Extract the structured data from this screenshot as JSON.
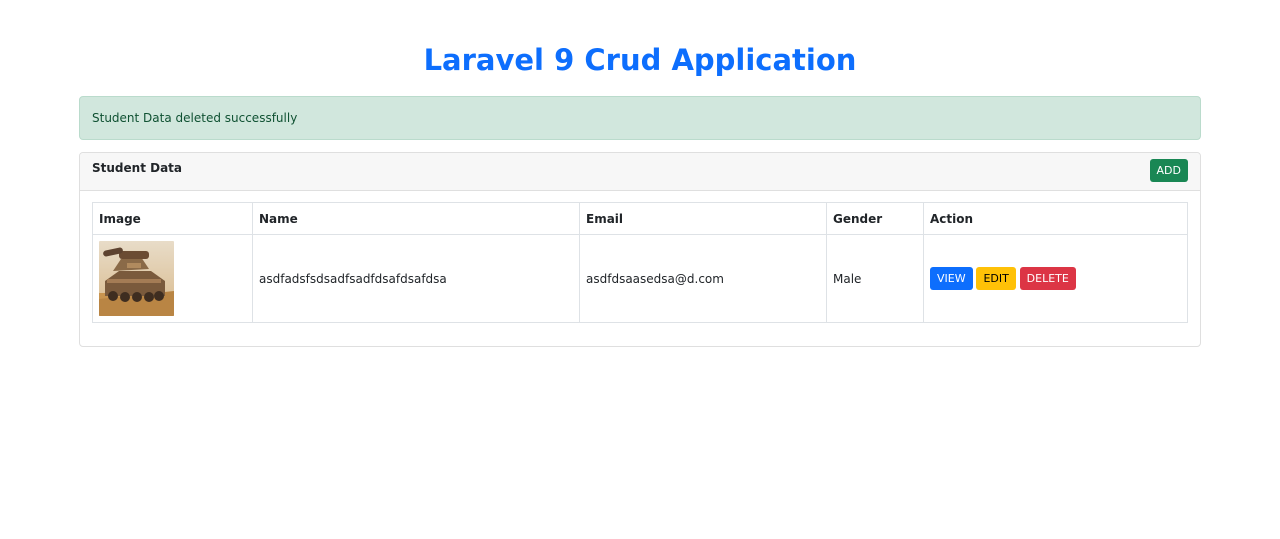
{
  "header": {
    "title": "Laravel 9 Crud Application"
  },
  "alert": {
    "message": "Student Data deleted successfully"
  },
  "card": {
    "title": "Student Data",
    "add_label": "ADD"
  },
  "table": {
    "columns": [
      "Image",
      "Name",
      "Email",
      "Gender",
      "Action"
    ],
    "rows": [
      {
        "image": "tank-photo",
        "name": "asdfadsfsdsadfsadfdsafdsafdsa",
        "email": "asdfdsaasedsa@d.com",
        "gender": "Male",
        "actions": {
          "view": "VIEW",
          "edit": "EDIT",
          "delete": "DELETE"
        }
      }
    ]
  },
  "colors": {
    "primary": "#0d6efd",
    "success": "#198754",
    "warning": "#ffc107",
    "danger": "#dc3545",
    "alert_bg": "#d1e7dd"
  }
}
